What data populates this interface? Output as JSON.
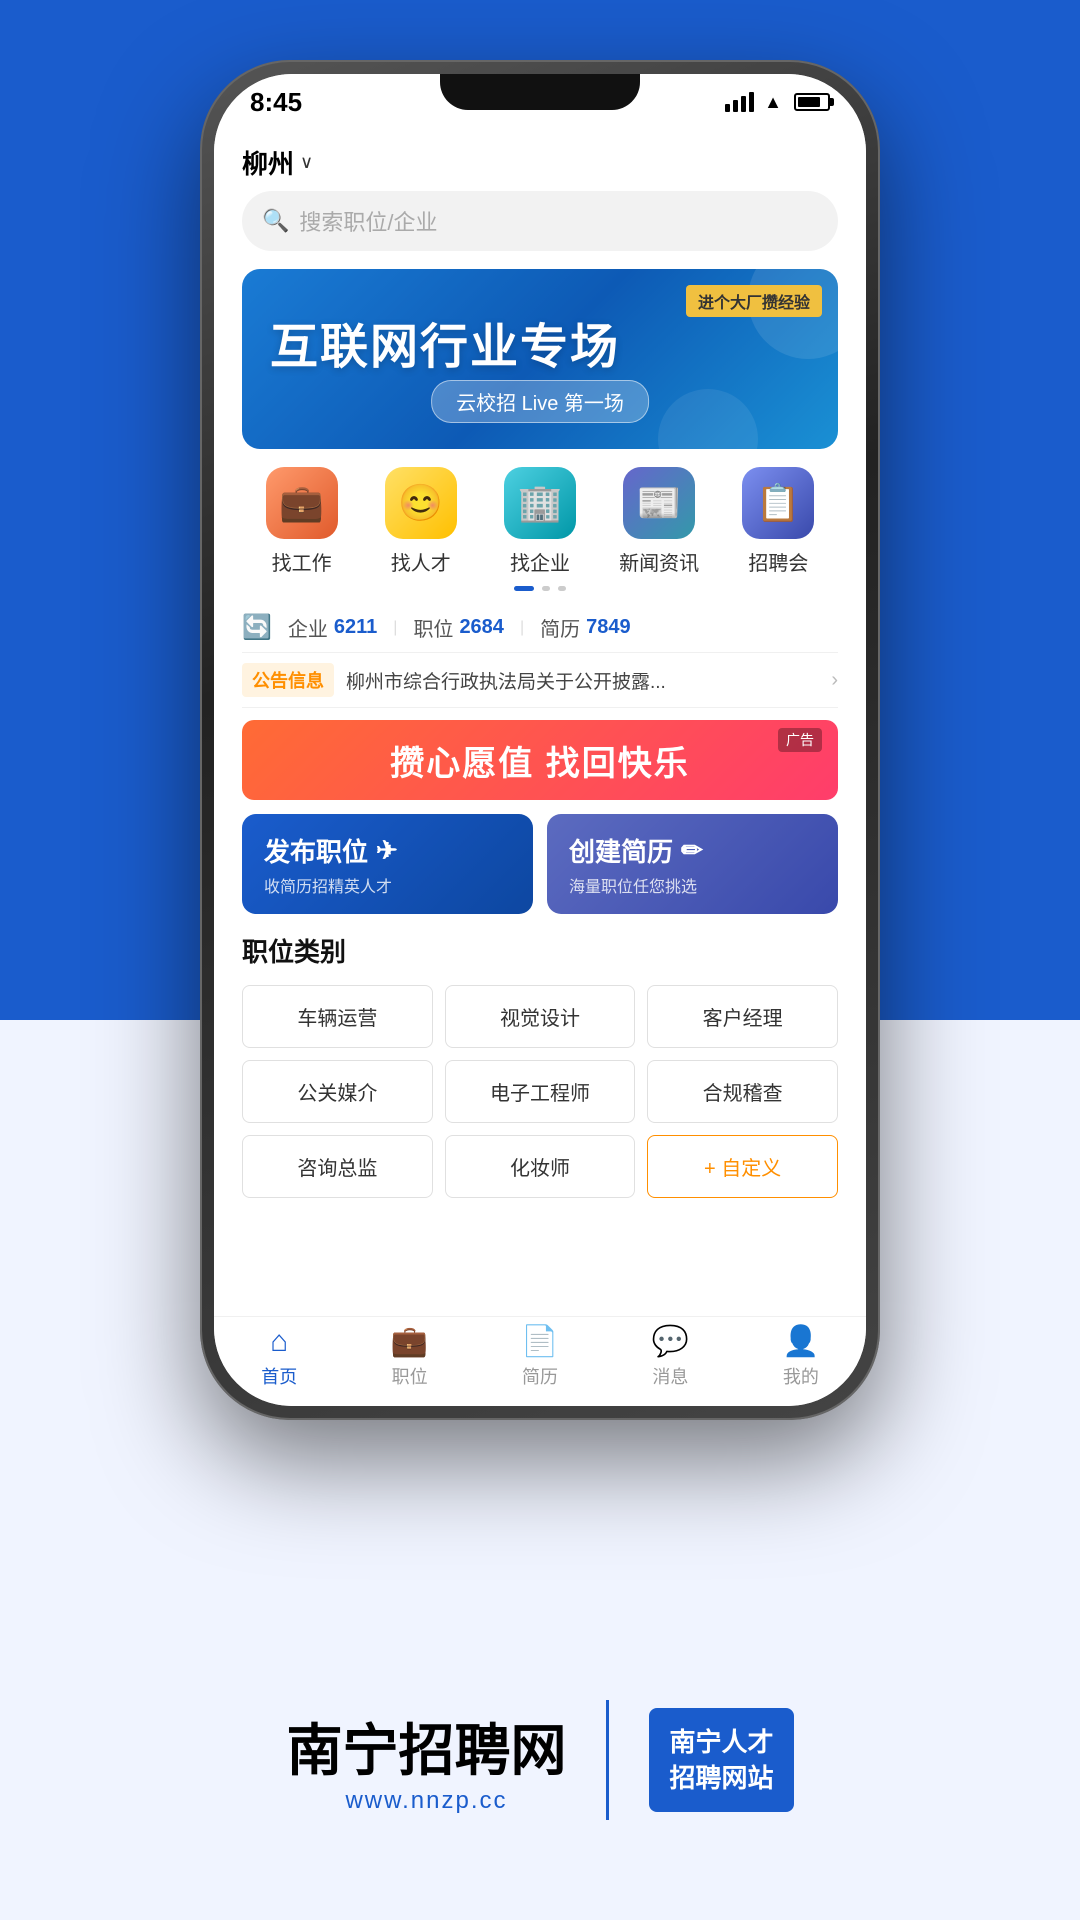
{
  "background": {
    "top_color": "#1a5ccc",
    "bottom_color": "#f0f4ff"
  },
  "status_bar": {
    "time": "8:45"
  },
  "location": {
    "city": "柳州",
    "dropdown_label": "柳州∨"
  },
  "search": {
    "placeholder": "搜索职位/企业"
  },
  "banner": {
    "tag": "进个大厂攒经验",
    "main_title": "互联网行业专场",
    "sub_title": "云校招 Live 第一场"
  },
  "quick_nav": [
    {
      "label": "找工作",
      "icon": "💼"
    },
    {
      "label": "找人才",
      "icon": "😊"
    },
    {
      "label": "找企业",
      "icon": "🏢"
    },
    {
      "label": "新闻资讯",
      "icon": "📰"
    },
    {
      "label": "招聘会",
      "icon": "📋"
    }
  ],
  "stats": {
    "enterprise_label": "企业",
    "enterprise_value": "6211",
    "job_label": "职位",
    "job_value": "2684",
    "resume_label": "简历",
    "resume_value": "7849"
  },
  "notice": {
    "tag": "公告信息",
    "text": "柳州市综合行政执法局关于公开披露..."
  },
  "ad_banner": {
    "text": "攒心愿值 找回快乐",
    "label": "广告"
  },
  "action_cards": [
    {
      "title": "发布职位",
      "icon": "✈",
      "subtitle": "收简历招精英人才"
    },
    {
      "title": "创建简历",
      "icon": "✏",
      "subtitle": "海量职位任您挑选"
    }
  ],
  "job_categories": {
    "section_title": "职位类别",
    "items": [
      "车辆运营",
      "视觉设计",
      "客户经理",
      "公关媒介",
      "电子工程师",
      "合规稽查",
      "咨询总监",
      "化妆师",
      "+ 自定义"
    ]
  },
  "tab_bar": [
    {
      "label": "首页",
      "icon": "🏠",
      "active": true
    },
    {
      "label": "职位",
      "icon": "💼",
      "active": false
    },
    {
      "label": "简历",
      "icon": "📄",
      "active": false
    },
    {
      "label": "消息",
      "icon": "💬",
      "active": false
    },
    {
      "label": "我的",
      "icon": "👤",
      "active": false
    }
  ],
  "branding": {
    "main_left": "南宁",
    "main_right": "招聘网",
    "url": "www.nnzp.cc",
    "badge_line1": "南宁人才",
    "badge_line2": "招聘网站"
  }
}
